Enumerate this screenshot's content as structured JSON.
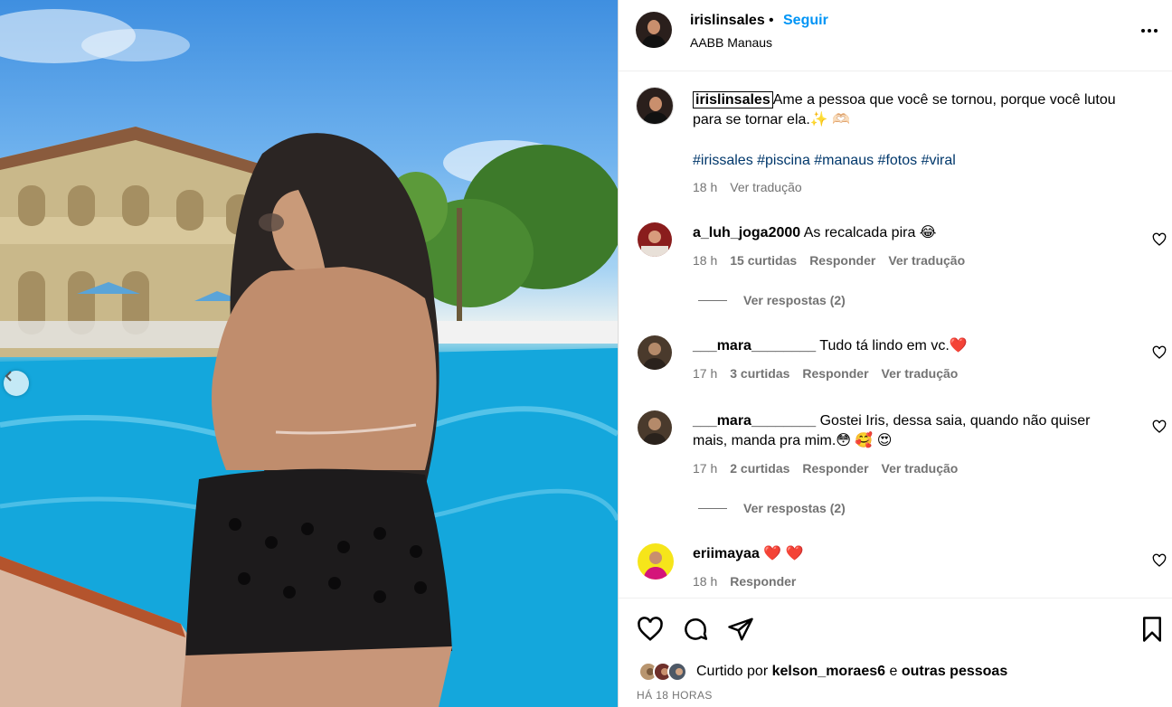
{
  "post": {
    "username": "irislinsales",
    "dot": "•",
    "follow_label": "Seguir",
    "location": "AABB Manaus",
    "more_icon": "more-horizontal-icon"
  },
  "caption": {
    "username": "irislinsales",
    "text": "Ame a pessoa que você se tornou, porque você lutou para se tornar ela.✨ 🫶🏻",
    "hashtags": "#irissales #piscina #manaus #fotos #viral",
    "time": "18 h",
    "translate": "Ver tradução"
  },
  "comments": [
    {
      "username": "a_luh_joga2000",
      "text": "As recalcada pira 😂",
      "time": "18 h",
      "likes": "15 curtidas",
      "reply": "Responder",
      "translate": "Ver tradução",
      "view_replies": "Ver respostas (2)"
    },
    {
      "username": "___mara________",
      "text": "Tudo tá lindo em vc.❤️",
      "time": "17 h",
      "likes": "3 curtidas",
      "reply": "Responder",
      "translate": "Ver tradução"
    },
    {
      "username": "___mara________",
      "text": "Gostei Iris, dessa saia, quando não quiser mais, manda pra mim.😳 🥰 😍",
      "time": "17 h",
      "likes": "2 curtidas",
      "reply": "Responder",
      "translate": "Ver tradução",
      "view_replies": "Ver respostas (2)"
    },
    {
      "username": "eriimayaa",
      "text": "❤️ ❤️",
      "time": "18 h",
      "reply": "Responder"
    }
  ],
  "footer": {
    "liked_by_prefix": "Curtido por",
    "liked_by_user": "kelson_moraes6",
    "liked_by_joiner": "e",
    "liked_by_others": "outras pessoas",
    "timestamp": "HÁ 18 HORAS"
  },
  "icons": {
    "like": "heart-icon",
    "comment": "comment-icon",
    "share": "send-icon",
    "save": "bookmark-icon",
    "prev": "chevron-left-icon"
  },
  "colors": {
    "accent": "#0095f6",
    "secondary_text": "#737373",
    "hashtag": "#00376b"
  }
}
